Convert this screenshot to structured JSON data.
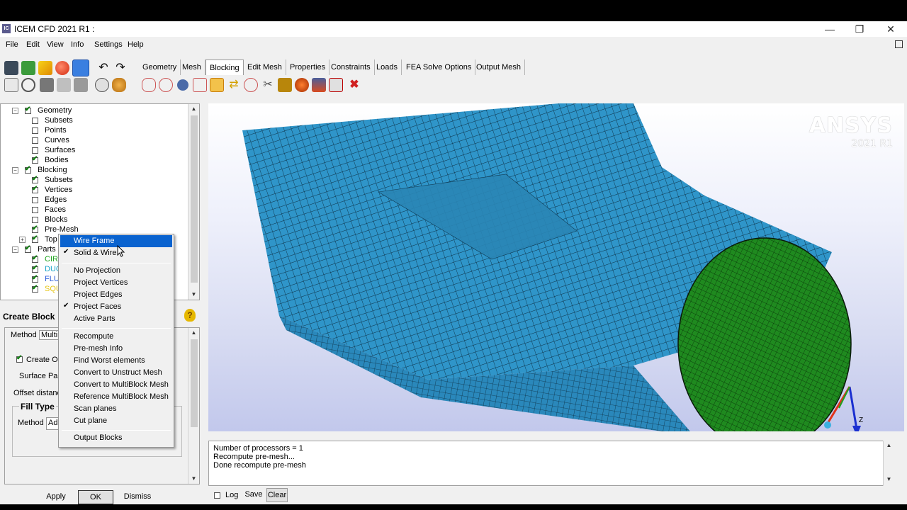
{
  "window": {
    "title": "ICEM CFD 2021 R1 :",
    "app_icon": "IC",
    "minimize": "—",
    "restore": "❐",
    "close": "✕"
  },
  "menubar": [
    "File",
    "Edit",
    "View",
    "Info",
    "Settings",
    "Help"
  ],
  "tabs": [
    "Geometry",
    "Mesh",
    "Blocking",
    "Edit Mesh",
    "Properties",
    "Constraints",
    "Loads",
    "FEA Solve Options",
    "Output Mesh"
  ],
  "active_tab": "Blocking",
  "tree": {
    "geometry": "Geometry",
    "g_subsets": "Subsets",
    "points": "Points",
    "curves": "Curves",
    "surfaces": "Surfaces",
    "bodies": "Bodies",
    "blocking": "Blocking",
    "b_subsets": "Subsets",
    "vertices": "Vertices",
    "edges": "Edges",
    "faces": "Faces",
    "blocks": "Blocks",
    "premesh": "Pre-Mesh",
    "topo": "Top",
    "parts": "Parts",
    "part1": "CIR",
    "part2": "DUC",
    "part3": "FLU",
    "part4": "SQU",
    "part1_color": "#1aa31a",
    "part2_color": "#1aa3c8",
    "part3_color": "#2a5ad8",
    "part4_color": "#e6c619"
  },
  "panel": {
    "title": "Create Block",
    "method_label": "Method",
    "method_value": "Multi",
    "create_og": "Create Og",
    "surface_parts": "Surface Part",
    "offset_distance": "Offset distanc",
    "fill_type": "Fill Type",
    "method2_label": "Method",
    "method2_value": "Ad"
  },
  "buttons": {
    "apply": "Apply",
    "ok": "OK",
    "dismiss": "Dismiss",
    "log": "Log",
    "save": "Save",
    "clear": "Clear"
  },
  "context_menu": {
    "items": [
      {
        "label": "Wire Frame",
        "highlighted": true,
        "checked": false
      },
      {
        "label": "Solid & Wire",
        "highlighted": false,
        "checked": true
      },
      {
        "label": "No Projection",
        "highlighted": false,
        "checked": false
      },
      {
        "label": "Project Vertices",
        "highlighted": false,
        "checked": false
      },
      {
        "label": "Project Edges",
        "highlighted": false,
        "checked": false
      },
      {
        "label": "Project Faces",
        "highlighted": false,
        "checked": true
      },
      {
        "label": "Active Parts",
        "highlighted": false,
        "checked": false
      },
      {
        "label": "Recompute",
        "highlighted": false,
        "checked": false
      },
      {
        "label": "Pre-mesh Info",
        "highlighted": false,
        "checked": false
      },
      {
        "label": "Find Worst elements",
        "highlighted": false,
        "checked": false
      },
      {
        "label": "Convert to Unstruct Mesh",
        "highlighted": false,
        "checked": false
      },
      {
        "label": "Convert to MultiBlock Mesh",
        "highlighted": false,
        "checked": false
      },
      {
        "label": "Reference MultiBlock Mesh",
        "highlighted": false,
        "checked": false
      },
      {
        "label": "Scan planes",
        "highlighted": false,
        "checked": false
      },
      {
        "label": "Cut plane",
        "highlighted": false,
        "checked": false
      },
      {
        "label": "Output Blocks",
        "highlighted": false,
        "checked": false
      }
    ]
  },
  "viewport": {
    "brand": "ANSYS",
    "version": "2021 R1",
    "axis_label": "Z",
    "mesh_color": "#2f95c9",
    "face_color": "#1f8a1f"
  },
  "messages": [
    "Number of processors = 1",
    "Recompute pre-mesh...",
    "Done recompute pre-mesh"
  ],
  "icons": {
    "toolbar": [
      "save-icon",
      "refresh-icon",
      "lightning-icon",
      "sphere-icon",
      "select-icon",
      "undo-icon",
      "redo-icon",
      "fit-icon",
      "zoom-icon",
      "view-icon",
      "measure-icon",
      "model-icon"
    ],
    "blocking_tools": [
      "create-block-icon",
      "split-block-icon",
      "merge-vertices-icon",
      "edit-block-icon",
      "associate-icon",
      "move-vertex-icon",
      "transform-icon",
      "edge-params-icon",
      "check-blocks-icon",
      "premesh-icon",
      "quality-icon",
      "smoothing-icon",
      "delete-block-icon",
      "xdelete-icon"
    ]
  }
}
